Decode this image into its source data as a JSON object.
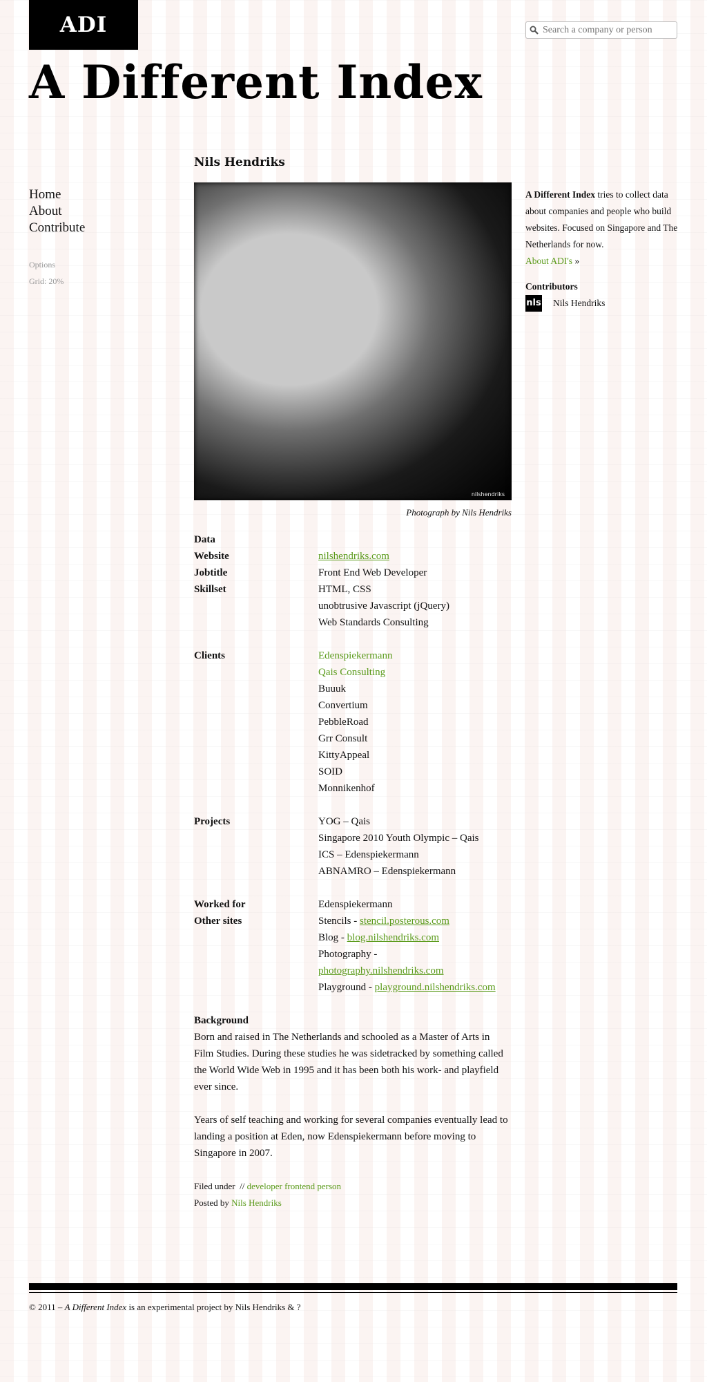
{
  "header": {
    "logo_text": "ADI",
    "search_placeholder": "Search a company or person",
    "site_title": "A Different Index"
  },
  "nav": {
    "items": [
      "Home",
      "About",
      "Contribute"
    ],
    "options_label": "Options",
    "grid_label": "Grid: 20%"
  },
  "person": {
    "name": "Nils Hendriks",
    "photo_watermark": "nilshendriks",
    "photo_caption": "Photograph by Nils Hendriks",
    "data_label": "Data",
    "website_label": "Website",
    "website_value": "nilshendriks.com",
    "jobtitle_label": "Jobtitle",
    "jobtitle_value": "Front End Web Developer",
    "skillset_label": "Skillset",
    "skillset": [
      "HTML, CSS",
      "unobtrusive Javascript (jQuery)",
      "Web Standards Consulting"
    ],
    "clients_label": "Clients",
    "clients": [
      "Edenspiekermann",
      "Qais Consulting",
      "Buuuk",
      "Convertium",
      "PebbleRoad",
      "Grr Consult",
      "KittyAppeal",
      "SOID",
      "Monnikenhof"
    ],
    "projects_label": "Projects",
    "projects": [
      "YOG – Qais",
      "Singapore 2010 Youth Olympic – Qais",
      "ICS – Edenspiekermann",
      "ABNAMRO – Edenspiekermann"
    ],
    "worked_for_label": "Worked for",
    "worked_for_value": "Edenspiekermann",
    "other_sites_label": "Other sites",
    "other_sites": [
      {
        "label": "Stencils - ",
        "link": "stencil.posterous.com"
      },
      {
        "label": "Blog - ",
        "link": "blog.nilshendriks.com"
      },
      {
        "label": "Photography -",
        "link": "photography.nilshendriks.com"
      },
      {
        "label": "Playground - ",
        "link": "playground.nilshendriks.com"
      }
    ],
    "background_label": "Background",
    "background_paragraphs": [
      "Born and raised in The Netherlands and schooled as a Master of Arts in Film Studies. During these studies he was sidetracked by something called the World Wide Web in 1995 and it has been both his work- and playfield ever since.",
      "Years of self teaching and working for several companies eventually lead to landing a position at Eden, now Edenspiekermann before moving to Singapore in 2007."
    ],
    "filed_under_label": "Filed under",
    "filed_under_sep": "//",
    "tags": "developer frontend person",
    "posted_by_label": "Posted by",
    "posted_by_value": "Nils Hendriks"
  },
  "sidebar": {
    "intro_bold": "A Different Index",
    "intro_text": " tries to collect data about companies and people who build websites. Focused on Singapore and The Netherlands for now.",
    "about_link": "About ADI's",
    "about_arrow": " »",
    "contributors_label": "Contributors",
    "contributor_avatar": "nls",
    "contributor_name": "Nils Hendriks"
  },
  "footer": {
    "prefix": "© 2011 – ",
    "title": "A Different Index",
    "suffix": " is an experimental project by Nils Hendriks & ?"
  },
  "colors": {
    "link": "#5a9a1a",
    "logo_bg": "#000000"
  }
}
